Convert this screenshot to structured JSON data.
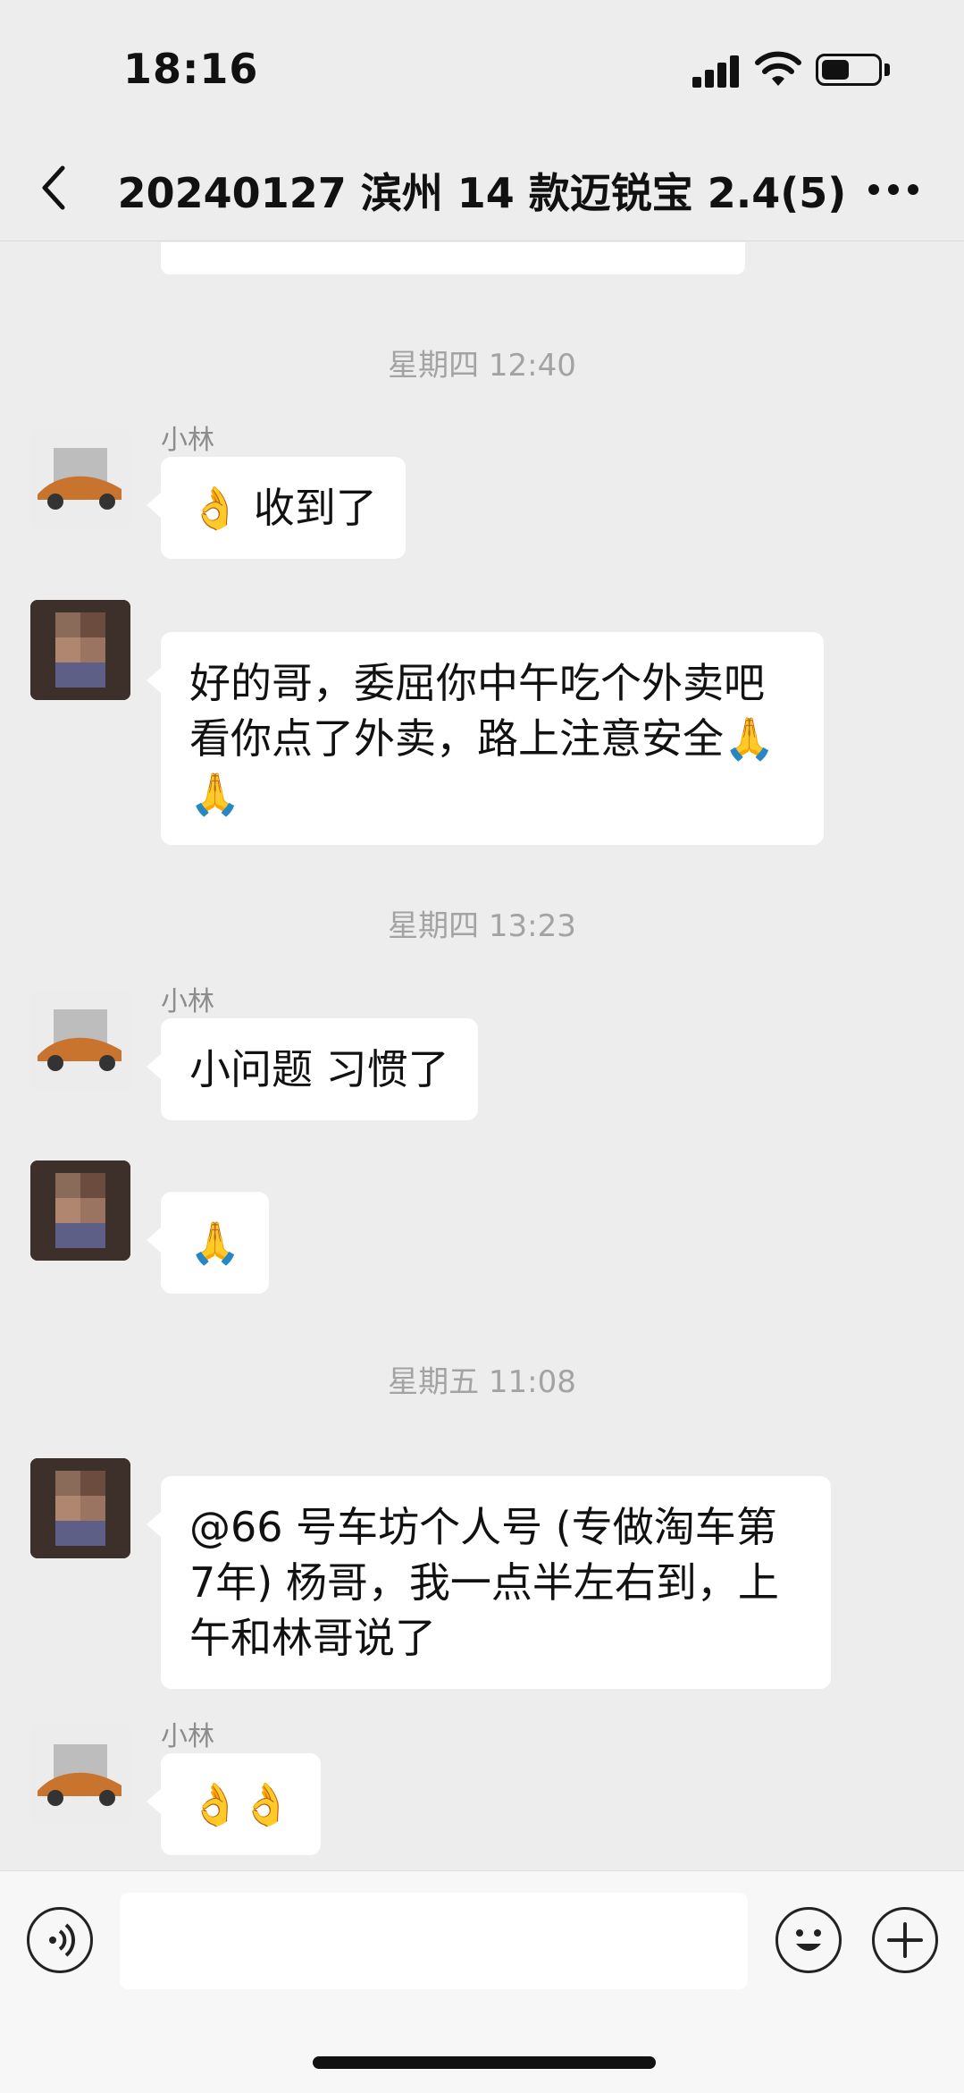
{
  "status_bar": {
    "time": "18:16"
  },
  "nav": {
    "title": "20240127 滨州 14 款迈锐宝 2.4(5)"
  },
  "messages": [
    {
      "type": "time",
      "text": "星期四 12:40"
    },
    {
      "type": "msg",
      "sender": "小林",
      "avatar": "car",
      "text": "👌 收到了"
    },
    {
      "type": "msg",
      "sender": "",
      "avatar": "person",
      "text": "好的哥，委屈你中午吃个外卖吧\n看你点了外卖，路上注意安全🙏\n🙏"
    },
    {
      "type": "time",
      "text": "星期四 13:23"
    },
    {
      "type": "msg",
      "sender": "小林",
      "avatar": "car",
      "text": "小问题 习惯了"
    },
    {
      "type": "msg",
      "sender": "",
      "avatar": "person",
      "text": "🙏"
    },
    {
      "type": "time",
      "text": "星期五 11:08"
    },
    {
      "type": "msg",
      "sender": "",
      "avatar": "person",
      "text": "@66 号车坊个人号 (专做淘车第\n7年) 杨哥，我一点半左右到，上\n午和林哥说了"
    },
    {
      "type": "msg",
      "sender": "小林",
      "avatar": "car",
      "text": "👌👌"
    }
  ],
  "input": {
    "placeholder": ""
  },
  "colors": {
    "background": "#ededed",
    "bubble": "#ffffff",
    "timestamp": "#a3a3a3"
  }
}
